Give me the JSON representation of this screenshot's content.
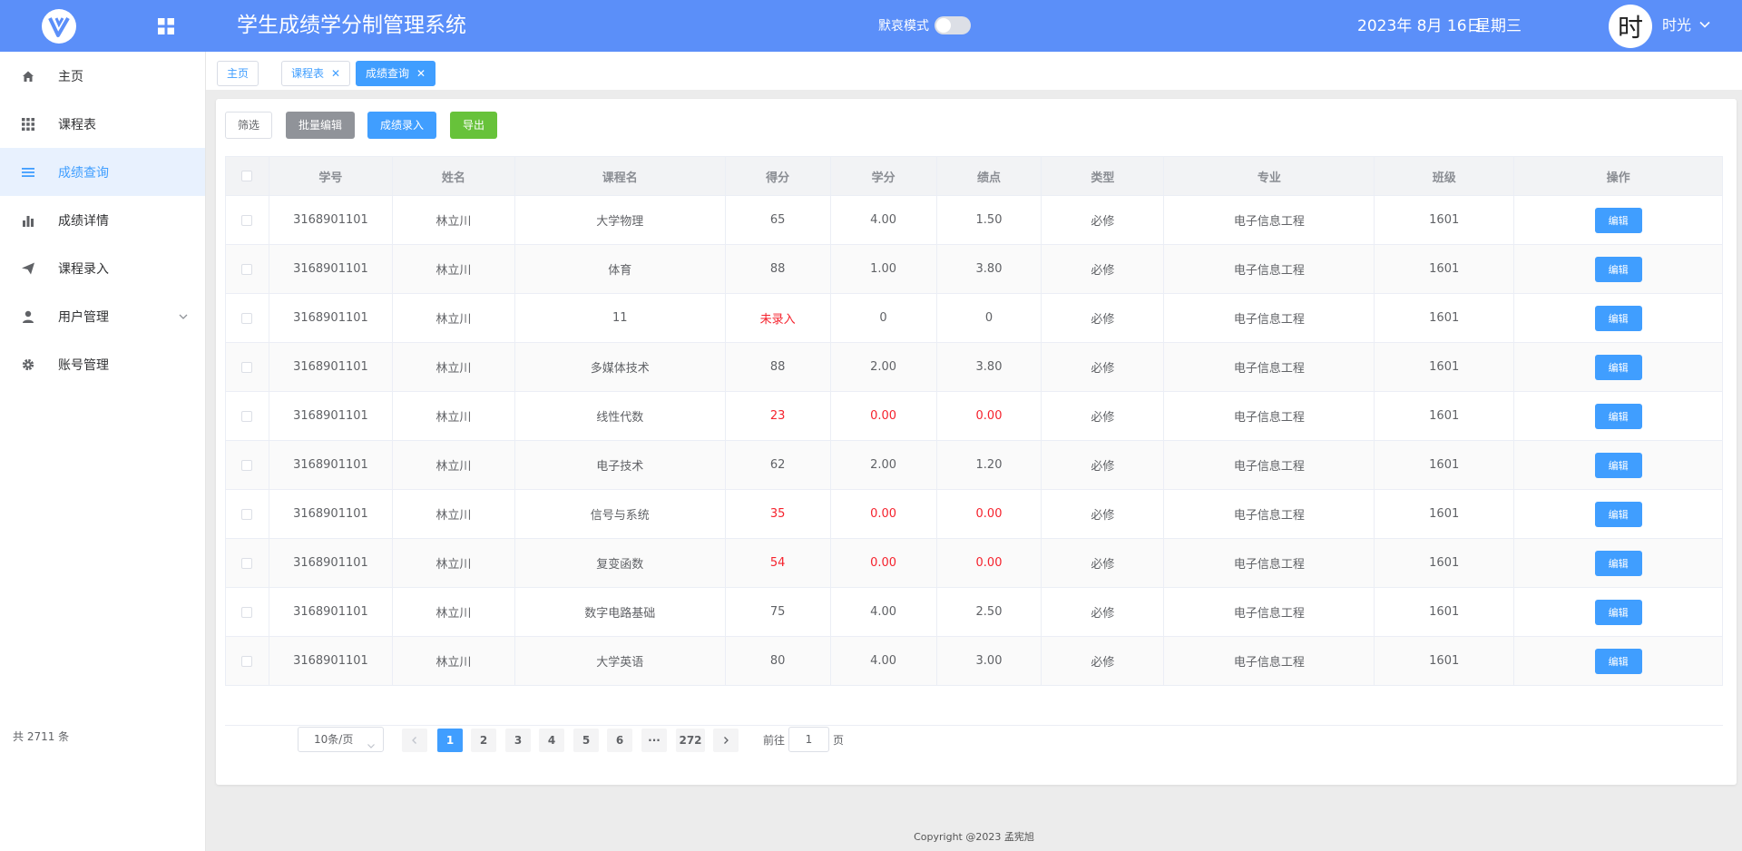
{
  "header": {
    "title": "学生成绩学分制管理系统",
    "mourning_mode_label": "默哀模式",
    "mourning_mode_on": false,
    "date": "2023年 8月 16日",
    "weekday": "星期三",
    "avatar_char": "时",
    "username": "时光"
  },
  "sidebar": {
    "items": [
      {
        "label": "主页",
        "icon": "home-icon"
      },
      {
        "label": "课程表",
        "icon": "grid-icon"
      },
      {
        "label": "成绩查询",
        "icon": "list-icon",
        "active": true
      },
      {
        "label": "成绩详情",
        "icon": "bar-chart-icon"
      },
      {
        "label": "课程录入",
        "icon": "send-icon"
      },
      {
        "label": "用户管理",
        "icon": "user-icon",
        "has_submenu": true
      },
      {
        "label": "账号管理",
        "icon": "gear-icon"
      }
    ]
  },
  "tabs": [
    {
      "label": "主页",
      "closable": false
    },
    {
      "label": "课程表",
      "closable": true
    },
    {
      "label": "成绩查询",
      "closable": true,
      "active": true
    }
  ],
  "toolbar": {
    "filter_label": "筛选",
    "batch_edit_label": "批量编辑",
    "entry_label": "成绩录入",
    "export_label": "导出"
  },
  "table": {
    "columns": [
      "学号",
      "姓名",
      "课程名",
      "得分",
      "学分",
      "绩点",
      "类型",
      "专业",
      "班级",
      "操作"
    ],
    "edit_label": "编辑",
    "rows": [
      [
        "3168901101",
        "林立川",
        "大学物理",
        "65",
        "4.00",
        "1.50",
        "必修",
        "电子信息工程",
        "1601"
      ],
      [
        "3168901101",
        "林立川",
        "体育",
        "88",
        "1.00",
        "3.80",
        "必修",
        "电子信息工程",
        "1601"
      ],
      [
        "3168901101",
        "林立川",
        "11",
        "未录入",
        "0",
        "0",
        "必修",
        "电子信息工程",
        "1601"
      ],
      [
        "3168901101",
        "林立川",
        "多媒体技术",
        "88",
        "2.00",
        "3.80",
        "必修",
        "电子信息工程",
        "1601"
      ],
      [
        "3168901101",
        "林立川",
        "线性代数",
        "23",
        "0.00",
        "0.00",
        "必修",
        "电子信息工程",
        "1601"
      ],
      [
        "3168901101",
        "林立川",
        "电子技术",
        "62",
        "2.00",
        "1.20",
        "必修",
        "电子信息工程",
        "1601"
      ],
      [
        "3168901101",
        "林立川",
        "信号与系统",
        "35",
        "0.00",
        "0.00",
        "必修",
        "电子信息工程",
        "1601"
      ],
      [
        "3168901101",
        "林立川",
        "复变函数",
        "54",
        "0.00",
        "0.00",
        "必修",
        "电子信息工程",
        "1601"
      ],
      [
        "3168901101",
        "林立川",
        "数字电路基础",
        "75",
        "4.00",
        "2.50",
        "必修",
        "电子信息工程",
        "1601"
      ],
      [
        "3168901101",
        "林立川",
        "大学英语",
        "80",
        "4.00",
        "3.00",
        "必修",
        "电子信息工程",
        "1601"
      ]
    ],
    "failing_rows": [
      2,
      4,
      6,
      7
    ]
  },
  "pagination": {
    "total_text": "共 2711 条",
    "page_size": "10条/页",
    "pages": [
      "1",
      "2",
      "3",
      "4",
      "5",
      "6",
      "···",
      "272"
    ],
    "current_page": "1",
    "goto_label": "前往",
    "goto_value": "1",
    "goto_unit": "页"
  },
  "footer": {
    "copyright": "Copyright @2023 孟宪旭"
  },
  "colors": {
    "header_bg": "#5b8ff9",
    "primary": "#409eff",
    "success": "#67c23a",
    "info": "#909399",
    "danger": "#f5222d"
  }
}
